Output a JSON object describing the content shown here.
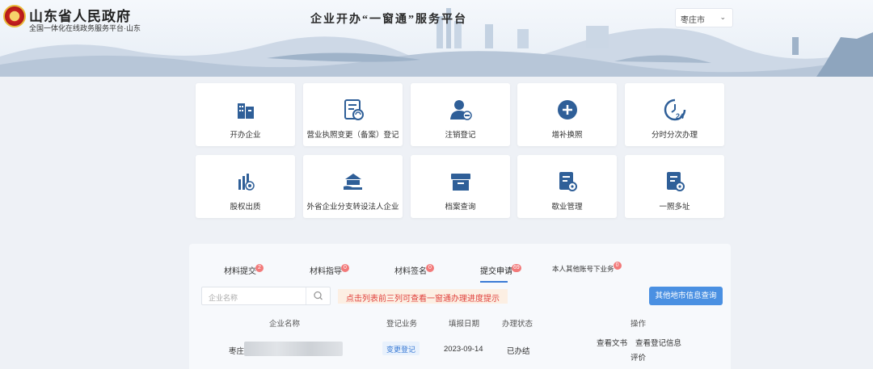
{
  "header": {
    "gov_title": "山东省人民政府",
    "gov_subtitle": "全国一体化在线政务服务平台·山东",
    "platform_title": "企业开办“一窗通”服务平台",
    "city_select": "枣庄市"
  },
  "services": [
    {
      "label": "开办企业",
      "icon": "building-icon"
    },
    {
      "label": "营业执照变更（备案）登记",
      "icon": "document-refresh-icon"
    },
    {
      "label": "注销登记",
      "icon": "user-minus-icon"
    },
    {
      "label": "增补换照",
      "icon": "plus-circle-icon"
    },
    {
      "label": "分时分次办理",
      "icon": "clock-24-icon"
    },
    {
      "label": "股权出质",
      "icon": "equity-chart-icon"
    },
    {
      "label": "外省企业分支转设法人企业",
      "icon": "bank-hand-icon"
    },
    {
      "label": "档案查询",
      "icon": "archive-box-icon"
    },
    {
      "label": "歇业管理",
      "icon": "document-gear-icon"
    },
    {
      "label": "一照多址",
      "icon": "document-settings-icon"
    }
  ],
  "tabs": [
    {
      "label": "材料提交",
      "badge": "2"
    },
    {
      "label": "材料指导",
      "badge": "0"
    },
    {
      "label": "材料签名",
      "badge": "0"
    },
    {
      "label": "提交申请",
      "badge": "69"
    },
    {
      "label": "本人其他账号下业务",
      "badge": "0"
    }
  ],
  "search": {
    "placeholder": "企业名称"
  },
  "hint": "点击列表前三列可查看一窗通办理进度提示",
  "query_button": "其他地市信息查询",
  "table": {
    "headers": [
      "企业名称",
      "登记业务",
      "填报日期",
      "办理状态",
      "操作"
    ],
    "rows": [
      {
        "name_prefix": "枣庄",
        "business": "变更登记",
        "date": "2023-09-14",
        "status": "已办结",
        "actions": [
          "查看文书",
          "查看登记信息",
          "评价"
        ]
      }
    ]
  },
  "colors": {
    "accent": "#4a90e2",
    "icon": "#2f5f98",
    "hint_text": "#e0413c",
    "badge": "#f27a7a"
  }
}
